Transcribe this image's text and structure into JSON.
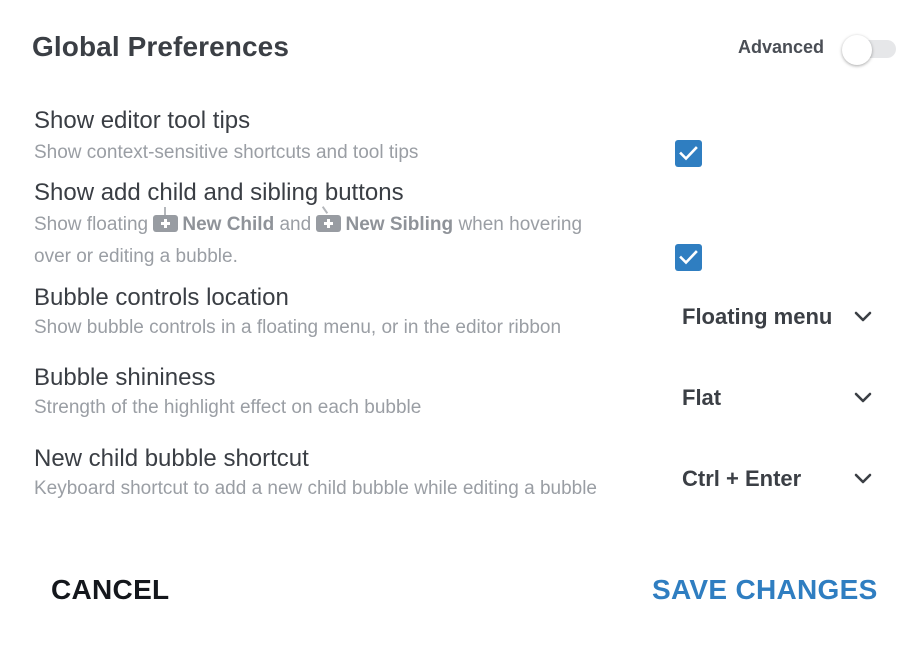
{
  "dialog": {
    "title": "Global Preferences",
    "advanced_label": "Advanced",
    "advanced_on": false
  },
  "settings": {
    "tooltips": {
      "title": "Show editor tool tips",
      "desc": "Show context-sensitive shortcuts and tool tips",
      "checked": true
    },
    "add_buttons": {
      "title": "Show add child and sibling buttons",
      "desc_prefix": "Show floating",
      "child_label": "New Child",
      "desc_and": "and",
      "sibling_label": "New Sibling",
      "desc_suffix_line1": "when hovering",
      "desc_line2": "over or editing a bubble.",
      "checked": true
    },
    "controls_location": {
      "title": "Bubble controls location",
      "desc": "Show bubble controls in a floating menu, or in the editor ribbon",
      "value": "Floating menu"
    },
    "shininess": {
      "title": "Bubble shininess",
      "desc": "Strength of the highlight effect on each bubble",
      "value": "Flat"
    },
    "child_shortcut": {
      "title": "New child bubble shortcut",
      "desc": "Keyboard shortcut to add a new child bubble while editing a bubble",
      "value": "Ctrl + Enter"
    }
  },
  "footer": {
    "cancel_label": "CANCEL",
    "save_label": "SAVE CHANGES"
  },
  "colors": {
    "accent": "#2f7ec1",
    "title_text": "#3b3f45",
    "muted_text": "#9a9ea4"
  },
  "icons": {
    "toggle": "toggle-switch",
    "checkbox": "checkmark-icon",
    "dropdown": "chevron-down-icon",
    "inline_add": "add-box-icon"
  }
}
